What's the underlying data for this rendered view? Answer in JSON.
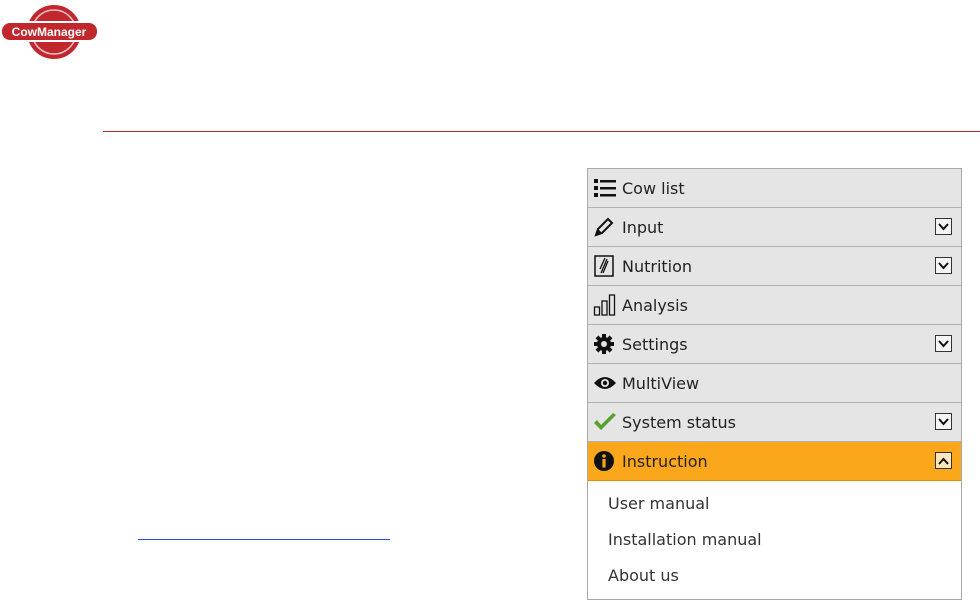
{
  "logo": {
    "text": "CowManager",
    "color": "#c0282e"
  },
  "colors": {
    "accent": "#fba71b",
    "divider": "#c0282e",
    "link": "#1a4fd6"
  },
  "menu": {
    "items": [
      {
        "label": "Cow list",
        "icon": "list-icon",
        "expandable": false
      },
      {
        "label": "Input",
        "icon": "pencil-icon",
        "expandable": true,
        "expanded": false
      },
      {
        "label": "Nutrition",
        "icon": "nutrition-icon",
        "expandable": true,
        "expanded": false
      },
      {
        "label": "Analysis",
        "icon": "bar-chart-icon",
        "expandable": false
      },
      {
        "label": "Settings",
        "icon": "gear-icon",
        "expandable": true,
        "expanded": false
      },
      {
        "label": "MultiView",
        "icon": "eye-icon",
        "expandable": false
      },
      {
        "label": "System status",
        "icon": "checkmark-icon",
        "expandable": true,
        "expanded": false
      },
      {
        "label": "Instruction",
        "icon": "info-icon",
        "expandable": true,
        "expanded": true,
        "active": true
      }
    ],
    "instruction_submenu": [
      {
        "label": "User manual"
      },
      {
        "label": "Installation manual"
      },
      {
        "label": "About us"
      }
    ]
  }
}
